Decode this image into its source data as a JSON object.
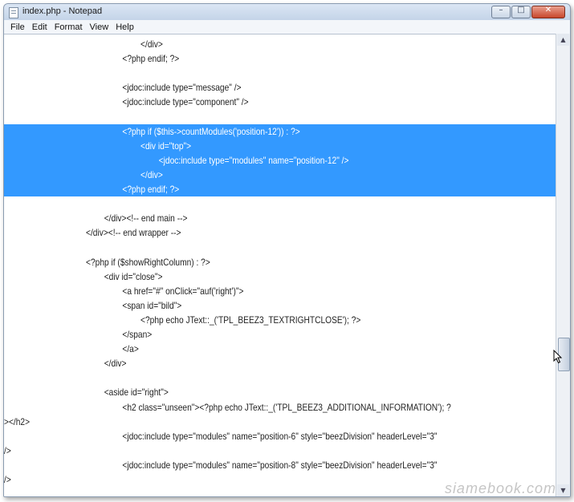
{
  "window": {
    "title": "index.php - Notepad",
    "controls": {
      "minimize": "–",
      "maximize": "□",
      "close": "✕"
    }
  },
  "menu": [
    "File",
    "Edit",
    "Format",
    "View",
    "Help"
  ],
  "lines": [
    {
      "text": "                                                            </div>",
      "selected": false
    },
    {
      "text": "                                                    <?php endif; ?>",
      "selected": false
    },
    {
      "text": "",
      "selected": false
    },
    {
      "text": "                                                    <jdoc:include type=\"message\" />",
      "selected": false
    },
    {
      "text": "                                                    <jdoc:include type=\"component\" />",
      "selected": false
    },
    {
      "text": "",
      "selected": false
    },
    {
      "text": "                                                    <?php if ($this->countModules('position-12')) : ?>",
      "selected": true
    },
    {
      "text": "                                                            <div id=\"top\">",
      "selected": true
    },
    {
      "text": "                                                                    <jdoc:include type=\"modules\" name=\"position-12\" />",
      "selected": true
    },
    {
      "text": "                                                            </div>",
      "selected": true
    },
    {
      "text": "                                                    <?php endif; ?>",
      "selected": true
    },
    {
      "text": "",
      "selected": false
    },
    {
      "text": "                                            </div><!-- end main -->",
      "selected": false
    },
    {
      "text": "                                    </div><!-- end wrapper -->",
      "selected": false
    },
    {
      "text": "",
      "selected": false
    },
    {
      "text": "                                    <?php if ($showRightColumn) : ?>",
      "selected": false
    },
    {
      "text": "                                            <div id=\"close\">",
      "selected": false
    },
    {
      "text": "                                                    <a href=\"#\" onClick=\"auf('right')\">",
      "selected": false
    },
    {
      "text": "                                                    <span id=\"bild\">",
      "selected": false
    },
    {
      "text": "                                                            <?php echo JText::_('TPL_BEEZ3_TEXTRIGHTCLOSE'); ?>",
      "selected": false
    },
    {
      "text": "                                                    </span>",
      "selected": false
    },
    {
      "text": "                                                    </a>",
      "selected": false
    },
    {
      "text": "                                            </div>",
      "selected": false
    },
    {
      "text": "",
      "selected": false
    },
    {
      "text": "                                            <aside id=\"right\">",
      "selected": false
    },
    {
      "text": "                                                    <h2 class=\"unseen\"><?php echo JText::_('TPL_BEEZ3_ADDITIONAL_INFORMATION'); ?",
      "selected": false
    },
    {
      "text": "></h2>",
      "selected": false
    },
    {
      "text": "                                                    <jdoc:include type=\"modules\" name=\"position-6\" style=\"beezDivision\" headerLevel=\"3\"",
      "selected": false
    },
    {
      "text": "/>",
      "selected": false
    },
    {
      "text": "                                                    <jdoc:include type=\"modules\" name=\"position-8\" style=\"beezDivision\" headerLevel=\"3\"",
      "selected": false
    },
    {
      "text": "/>",
      "selected": false
    }
  ],
  "scrollbar": {
    "position_fraction": 0.72,
    "up_icon": "▲",
    "down_icon": "▼"
  },
  "watermark": "siamebook.com",
  "colors": {
    "selection": "#3399ff",
    "text": "#1f1f1f"
  }
}
